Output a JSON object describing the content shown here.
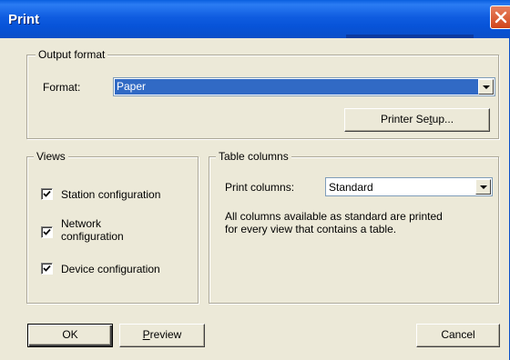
{
  "window": {
    "title": "Print"
  },
  "output_format": {
    "legend": "Output format",
    "format_label": "Format:",
    "format_value": "Paper",
    "printer_setup_prefix": "Printer Se",
    "printer_setup_mnemonic": "t",
    "printer_setup_suffix": "up..."
  },
  "views": {
    "legend": "Views",
    "items": [
      {
        "label": "Station configuration",
        "checked": true
      },
      {
        "label_line1": "Network",
        "label_line2": "configuration",
        "checked": true
      },
      {
        "label": "Device configuration",
        "checked": true
      }
    ]
  },
  "table_columns": {
    "legend": "Table columns",
    "print_columns_label": "Print columns:",
    "print_columns_value": "Standard",
    "description_line1": "All columns available as standard are printed",
    "description_line2": "for every view that contains a table."
  },
  "buttons": {
    "ok": "OK",
    "preview_mnemonic": "P",
    "preview_rest": "review",
    "cancel": "Cancel"
  }
}
